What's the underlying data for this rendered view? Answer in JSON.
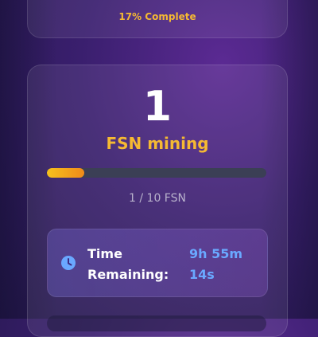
{
  "top_card": {
    "percent_complete_label": "17% Complete"
  },
  "mining_card": {
    "count": "1",
    "label": "FSN mining",
    "progress": {
      "current": 1,
      "total": 10,
      "fraction": 0.17,
      "text": "1 / 10 FSN"
    },
    "time": {
      "label_line1": "Time",
      "label_line2": "Remaining:",
      "value_line1": "9h 55m",
      "value_line2": "14s"
    }
  },
  "colors": {
    "accent_gold": "#f5b932",
    "progress_start": "#f6c21c",
    "progress_end": "#f08a1a",
    "time_value_blue": "#6aa8ff"
  },
  "icons": {
    "time": "clock-icon"
  }
}
